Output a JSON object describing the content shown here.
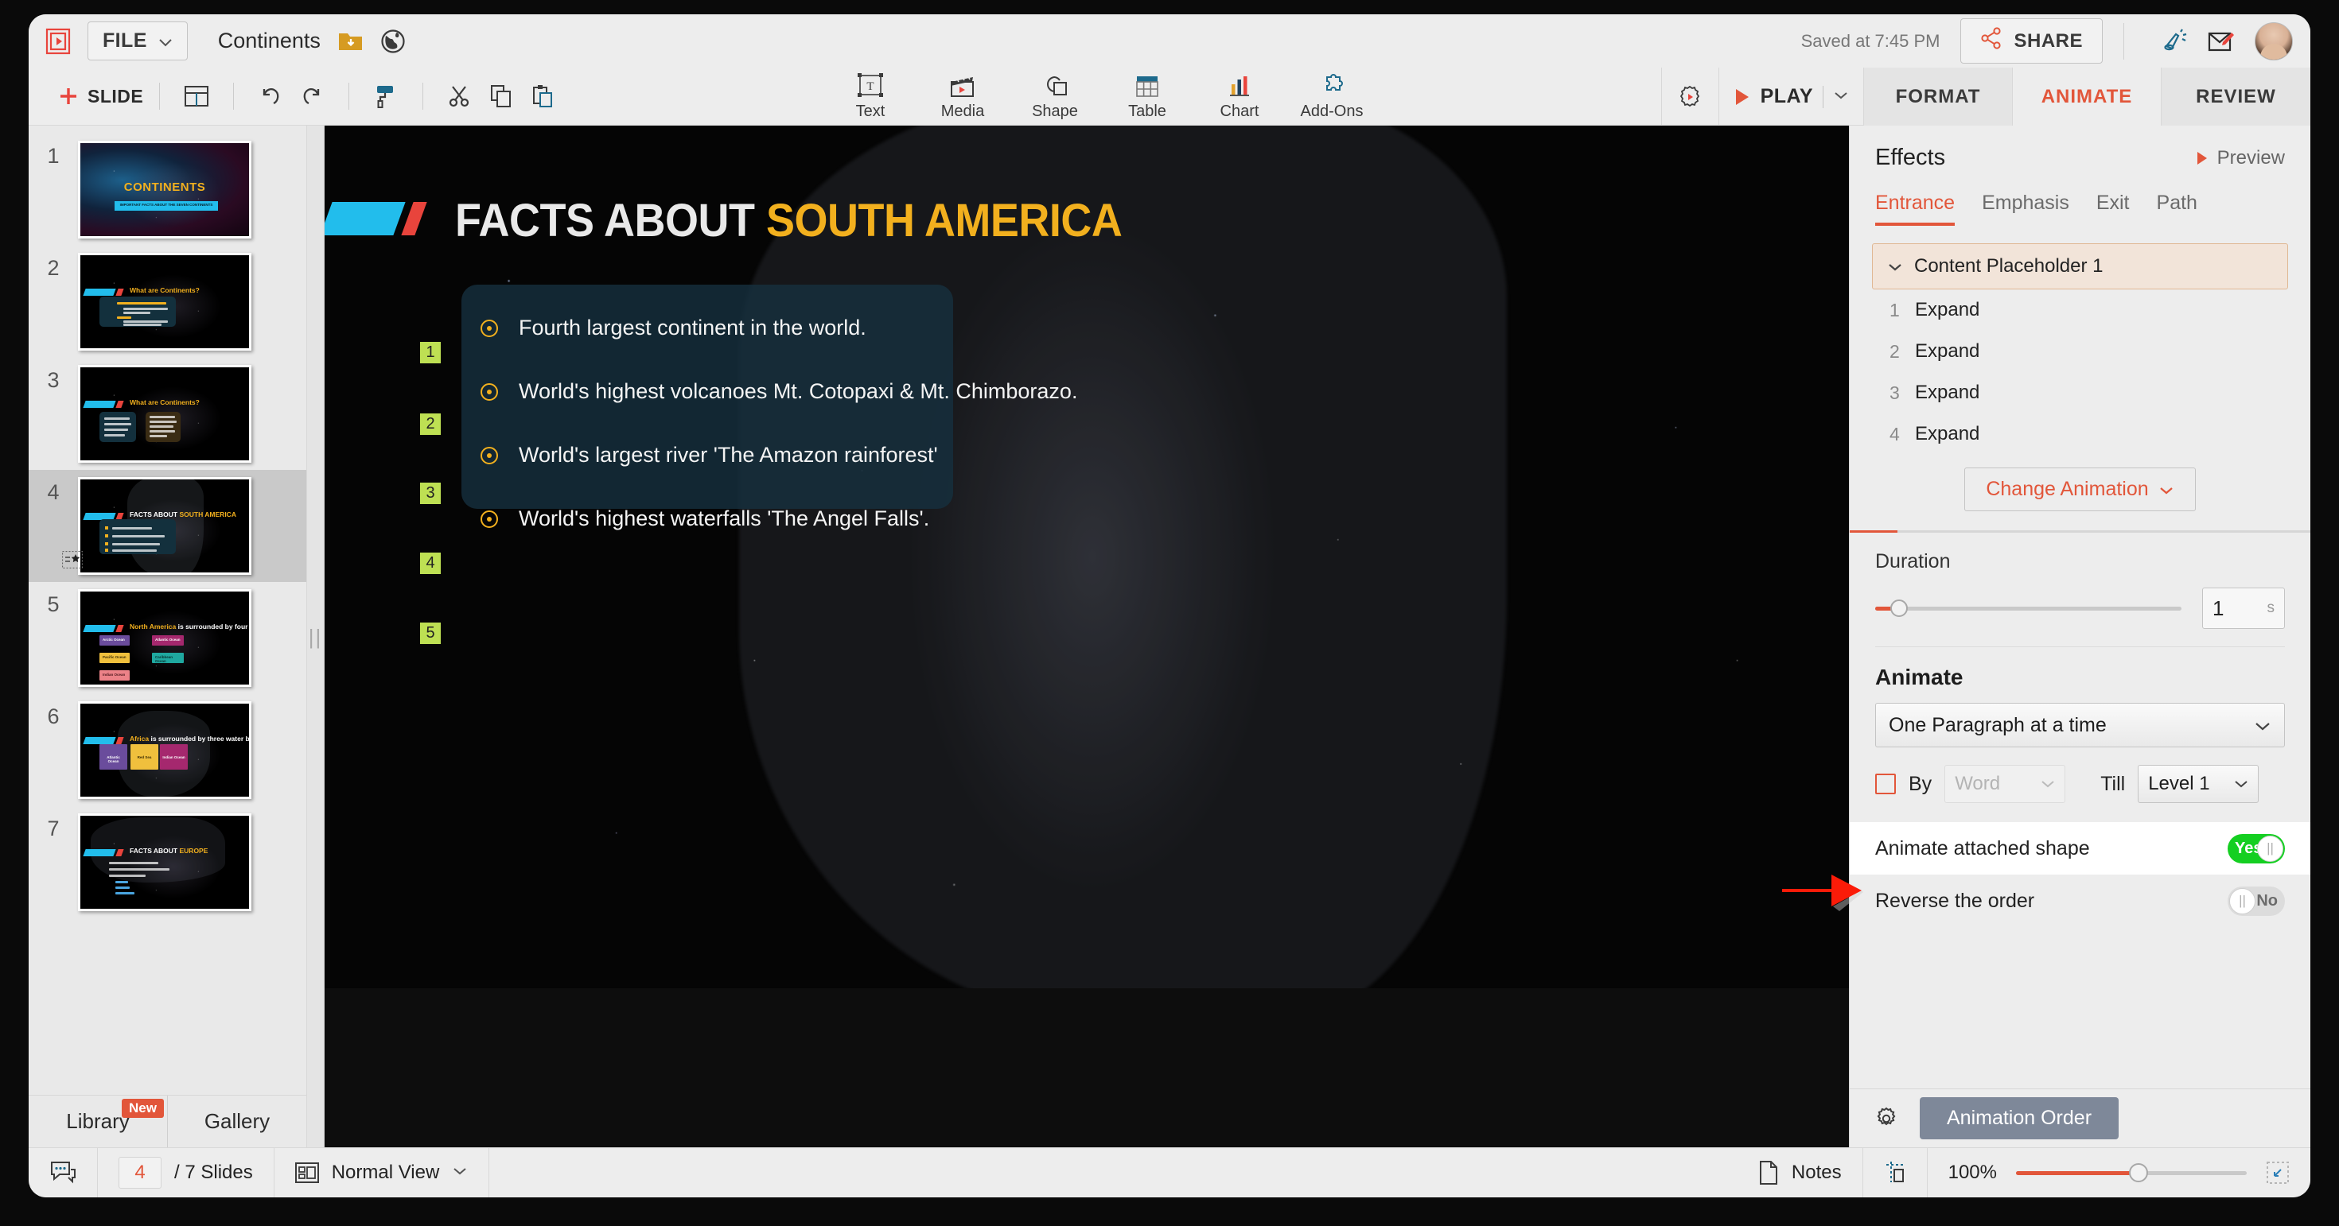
{
  "header": {
    "logo_icon": "presentation-logo-icon",
    "file_menu": "FILE",
    "doc_title": "Continents",
    "folder_icon": "folder-download-icon",
    "globe_icon": "globe-icon",
    "saved_status": "Saved at 7:45 PM",
    "share_label": "SHARE",
    "share_icon": "share-nodes-icon",
    "announce_icon": "megaphone-icon",
    "feedback_icon": "edit-envelope-icon",
    "avatar": "user-avatar"
  },
  "toolbar": {
    "slide_label": "SLIDE",
    "layout_icon": "slide-layout-icon",
    "undo_icon": "undo-icon",
    "redo_icon": "redo-icon",
    "format_painter_icon": "format-painter-icon",
    "cut_icon": "scissors-icon",
    "copy_icon": "copy-icon",
    "paste_icon": "paste-icon",
    "insert_tools": [
      {
        "label": "Text",
        "icon": "text-box-icon"
      },
      {
        "label": "Media",
        "icon": "media-clapperboard-icon"
      },
      {
        "label": "Shape",
        "icon": "shape-icon"
      },
      {
        "label": "Table",
        "icon": "table-icon"
      },
      {
        "label": "Chart",
        "icon": "bar-chart-icon"
      },
      {
        "label": "Add-Ons",
        "icon": "puzzle-piece-icon"
      }
    ],
    "settings_icon": "gear-play-icon",
    "play_label": "PLAY",
    "play_icon": "play-triangle-icon",
    "play_dropdown_icon": "chevron-down-icon",
    "ribbon_tabs": [
      {
        "label": "FORMAT",
        "active": false
      },
      {
        "label": "ANIMATE",
        "active": true
      },
      {
        "label": "REVIEW",
        "active": false
      }
    ]
  },
  "slides_panel": {
    "slides": [
      {
        "num": "1",
        "title": "CONTINENTS",
        "selected": false
      },
      {
        "num": "2",
        "title": "What are Continents?",
        "selected": false
      },
      {
        "num": "3",
        "title": "What are Continents?",
        "selected": false
      },
      {
        "num": "4",
        "title": "FACTS ABOUT SOUTH AMERICA",
        "selected": true
      },
      {
        "num": "5",
        "title": "North America is surrounded by four water bodies:",
        "selected": false
      },
      {
        "num": "6",
        "title": "Africa is surrounded by three water bodies",
        "selected": false
      },
      {
        "num": "7",
        "title": "FACTS ABOUT EUROPE",
        "selected": false
      }
    ],
    "slide1_subtitle": "IMPORTANT FACTS ABOUT THE SEVEN CONTINENTS",
    "slide5_chips": [
      "Arctic Ocean",
      "Atlantic Ocean",
      "Pacific Ocean",
      "Caribbean Ocean",
      "Indian Ocean"
    ],
    "slide6_chips": [
      "Atlantic Ocean",
      "Red Sea",
      "Indian Ocean"
    ],
    "tabs": [
      {
        "label": "Library",
        "badge": "New"
      },
      {
        "label": "Gallery",
        "badge": ""
      }
    ],
    "drag_handle_icon": "drag-handle-icon"
  },
  "slide": {
    "title_plain": "FACTS ABOUT ",
    "title_highlight": "SOUTH AMERICA",
    "bullets": [
      "Fourth largest continent in the world.",
      "World's highest volcanoes Mt. Cotopaxi & Mt. Chimborazo.",
      "World's largest river 'The Amazon rainforest'",
      "World's highest waterfalls 'The Angel Falls'."
    ],
    "animation_markers": [
      "1",
      "2",
      "3",
      "4",
      "5"
    ],
    "bullet_icon": "target-dot-icon"
  },
  "animate_panel": {
    "effects_title": "Effects",
    "preview_label": "Preview",
    "preview_icon": "play-triangle-icon",
    "effect_tabs": [
      {
        "label": "Entrance",
        "active": true
      },
      {
        "label": "Emphasis",
        "active": false
      },
      {
        "label": "Exit",
        "active": false
      },
      {
        "label": "Path",
        "active": false
      }
    ],
    "placeholder_label": "Content Placeholder 1",
    "placeholder_chevron_icon": "chevron-down-icon",
    "effect_items": [
      {
        "num": "1",
        "label": "Expand"
      },
      {
        "num": "2",
        "label": "Expand"
      },
      {
        "num": "3",
        "label": "Expand"
      },
      {
        "num": "4",
        "label": "Expand"
      }
    ],
    "change_animation_label": "Change Animation",
    "change_animation_icon": "chevron-down-icon",
    "duration_label": "Duration",
    "duration_value": "1",
    "duration_unit": "s",
    "animate_label": "Animate",
    "animate_mode": "One Paragraph at a time",
    "by_label": "By",
    "by_value": "Word",
    "till_label": "Till",
    "till_value": "Level 1",
    "animate_attached_label": "Animate attached shape",
    "animate_attached_value": "Yes",
    "reverse_order_label": "Reverse the order",
    "reverse_order_value": "No",
    "footer_gear_icon": "gear-icon",
    "animation_order_label": "Animation Order",
    "callout_arrow_icon": "red-arrow-icon"
  },
  "statusbar": {
    "comment_icon": "comment-icon",
    "current_slide": "4",
    "slide_count": "/ 7 Slides",
    "view_icon": "normal-view-icon",
    "view_label": "Normal View",
    "view_chevron_icon": "chevron-down-icon",
    "notes_icon": "notes-page-icon",
    "notes_label": "Notes",
    "guides_icon": "guides-icon",
    "zoom_level": "100%",
    "fit_icon": "fit-to-screen-icon"
  },
  "colors": {
    "accent_red": "#e2563a",
    "toggle_green": "#14cf21",
    "marker_green": "#bee053",
    "slide_gold": "#f2b01e",
    "slide_cyan": "#22bdec",
    "panel_bg": "#ededed"
  }
}
